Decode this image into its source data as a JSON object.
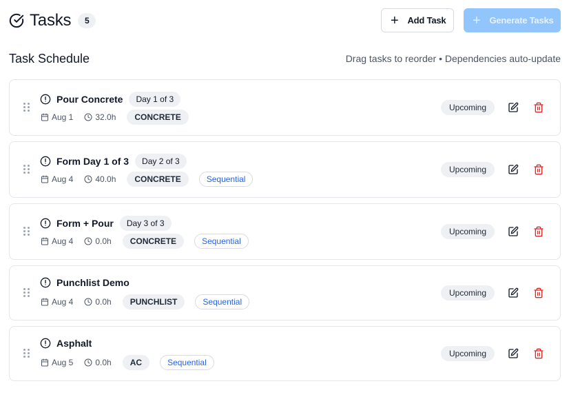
{
  "header": {
    "title": "Tasks",
    "count": "5",
    "add_task_label": "Add Task",
    "generate_tasks_label": "Generate Tasks"
  },
  "section": {
    "title": "Task Schedule",
    "hint": "Drag tasks to reorder • Dependencies auto-update"
  },
  "tasks": [
    {
      "name": "Pour Concrete",
      "day": "Day 1 of 3",
      "date": "Aug 1",
      "hours": "32.0h",
      "category": "CONCRETE",
      "sequential": "",
      "status": "Upcoming"
    },
    {
      "name": "Form Day 1 of 3",
      "day": "Day 2 of 3",
      "date": "Aug 4",
      "hours": "40.0h",
      "category": "CONCRETE",
      "sequential": "Sequential",
      "status": "Upcoming"
    },
    {
      "name": "Form + Pour",
      "day": "Day 3 of 3",
      "date": "Aug 4",
      "hours": "0.0h",
      "category": "CONCRETE",
      "sequential": "Sequential",
      "status": "Upcoming"
    },
    {
      "name": "Punchlist Demo",
      "day": "",
      "date": "Aug 4",
      "hours": "0.0h",
      "category": "PUNCHLIST",
      "sequential": "Sequential",
      "status": "Upcoming"
    },
    {
      "name": "Asphalt",
      "day": "",
      "date": "Aug 5",
      "hours": "0.0h",
      "category": "AC",
      "sequential": "Sequential",
      "status": "Upcoming"
    }
  ],
  "colors": {
    "accent_disabled": "#93c5fd",
    "sequential_text": "#2563eb",
    "delete_icon": "#dc2626",
    "badge_bg": "#eef0f3"
  },
  "icons": [
    "check-circle-icon",
    "plus-icon",
    "drag-handle-icon",
    "alert-circle-icon",
    "calendar-icon",
    "clock-icon",
    "edit-icon",
    "trash-icon"
  ]
}
